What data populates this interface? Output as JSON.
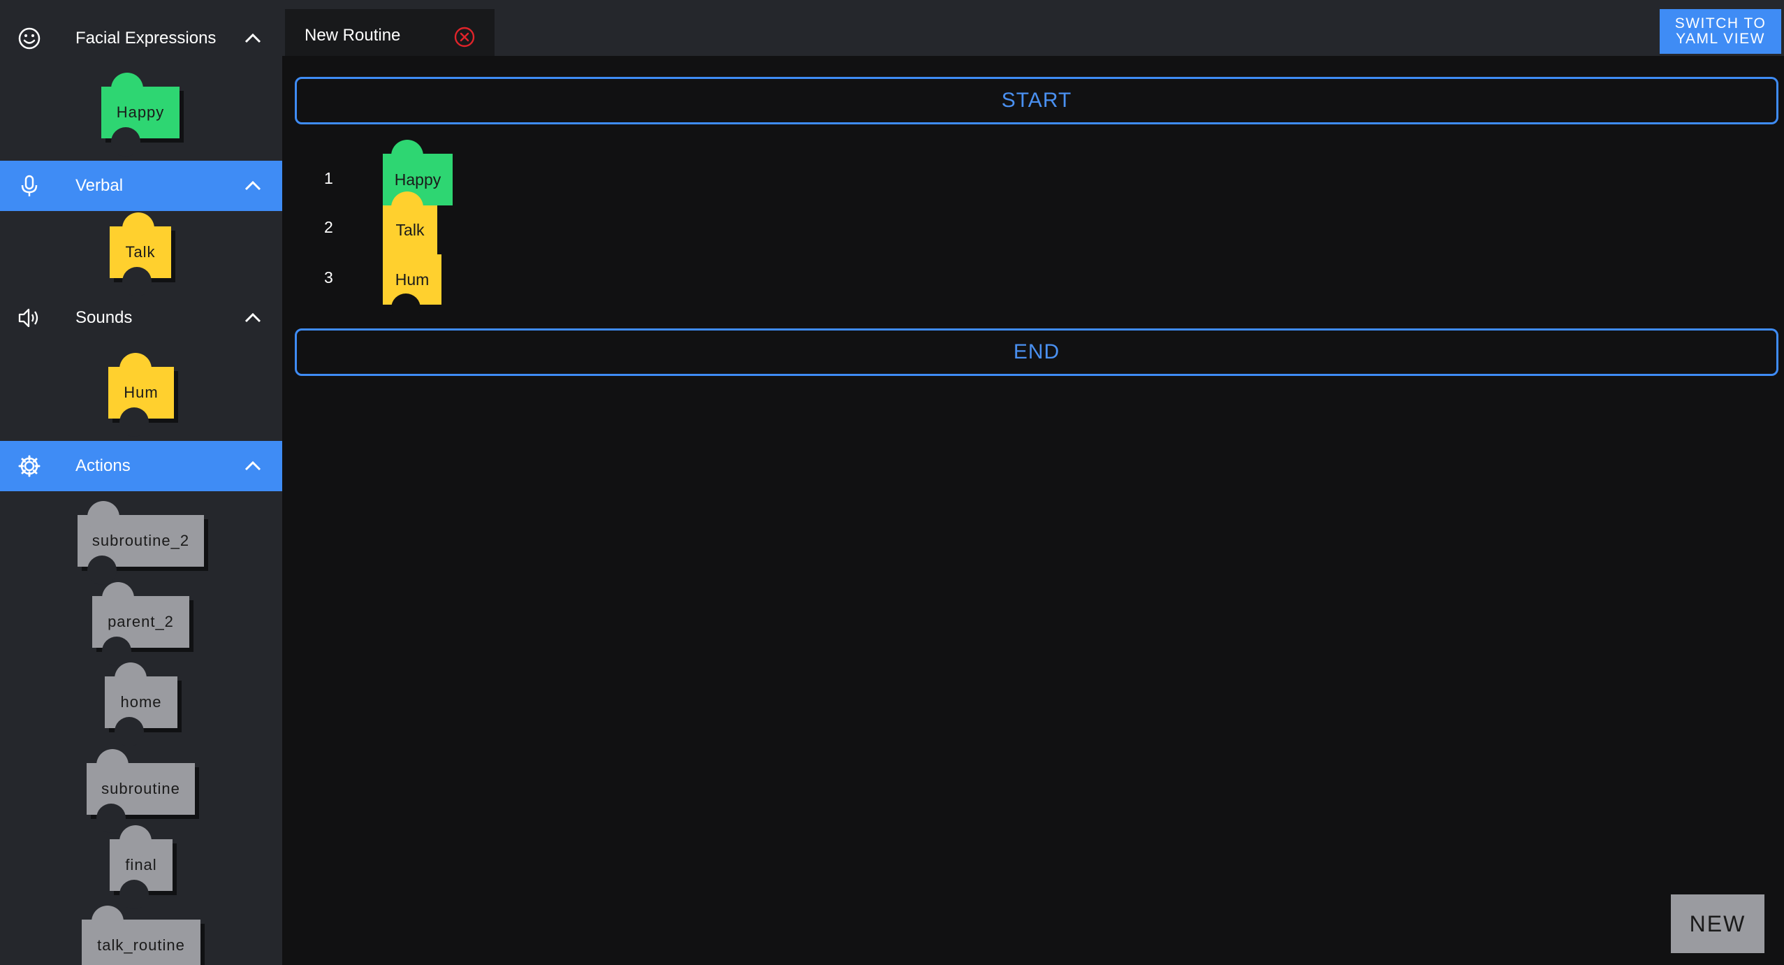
{
  "sidebar": {
    "sections": [
      {
        "label": "Facial Expressions",
        "icon": "smiley-face-icon",
        "expanded": true,
        "blocks": [
          {
            "label": "Happy",
            "color": "#2ed672"
          }
        ]
      },
      {
        "label": "Verbal",
        "icon": "microphone-icon",
        "expanded": true,
        "active": true,
        "blocks": [
          {
            "label": "Talk",
            "color": "#ffd02e"
          }
        ]
      },
      {
        "label": "Sounds",
        "icon": "speaker-icon",
        "expanded": true,
        "blocks": [
          {
            "label": "Hum",
            "color": "#ffd02e"
          }
        ]
      },
      {
        "label": "Actions",
        "icon": "gear-icon",
        "expanded": true,
        "active": true,
        "blocks": [
          {
            "label": "subroutine_2",
            "color": "#9a9ba0"
          },
          {
            "label": "parent_2",
            "color": "#9a9ba0"
          },
          {
            "label": "home",
            "color": "#9a9ba0"
          },
          {
            "label": "subroutine",
            "color": "#9a9ba0"
          },
          {
            "label": "final",
            "color": "#9a9ba0"
          },
          {
            "label": "talk_routine",
            "color": "#9a9ba0"
          }
        ]
      }
    ]
  },
  "tabs": [
    {
      "label": "New Routine",
      "close_icon": "close-circle-icon"
    }
  ],
  "toolbar": {
    "yaml_button_line1": "SWITCH TO",
    "yaml_button_line2": "YAML VIEW"
  },
  "routine": {
    "start_label": "START",
    "end_label": "END",
    "steps": [
      {
        "number": "1",
        "label": "Happy",
        "color": "#2ed672"
      },
      {
        "number": "2",
        "label": "Talk",
        "color": "#ffd02e"
      },
      {
        "number": "3",
        "label": "Hum",
        "color": "#ffd02e"
      }
    ]
  },
  "new_button_label": "NEW",
  "colors": {
    "accent": "#3f8cf5",
    "sidebar_bg": "#25272c",
    "canvas_bg": "#111112"
  }
}
